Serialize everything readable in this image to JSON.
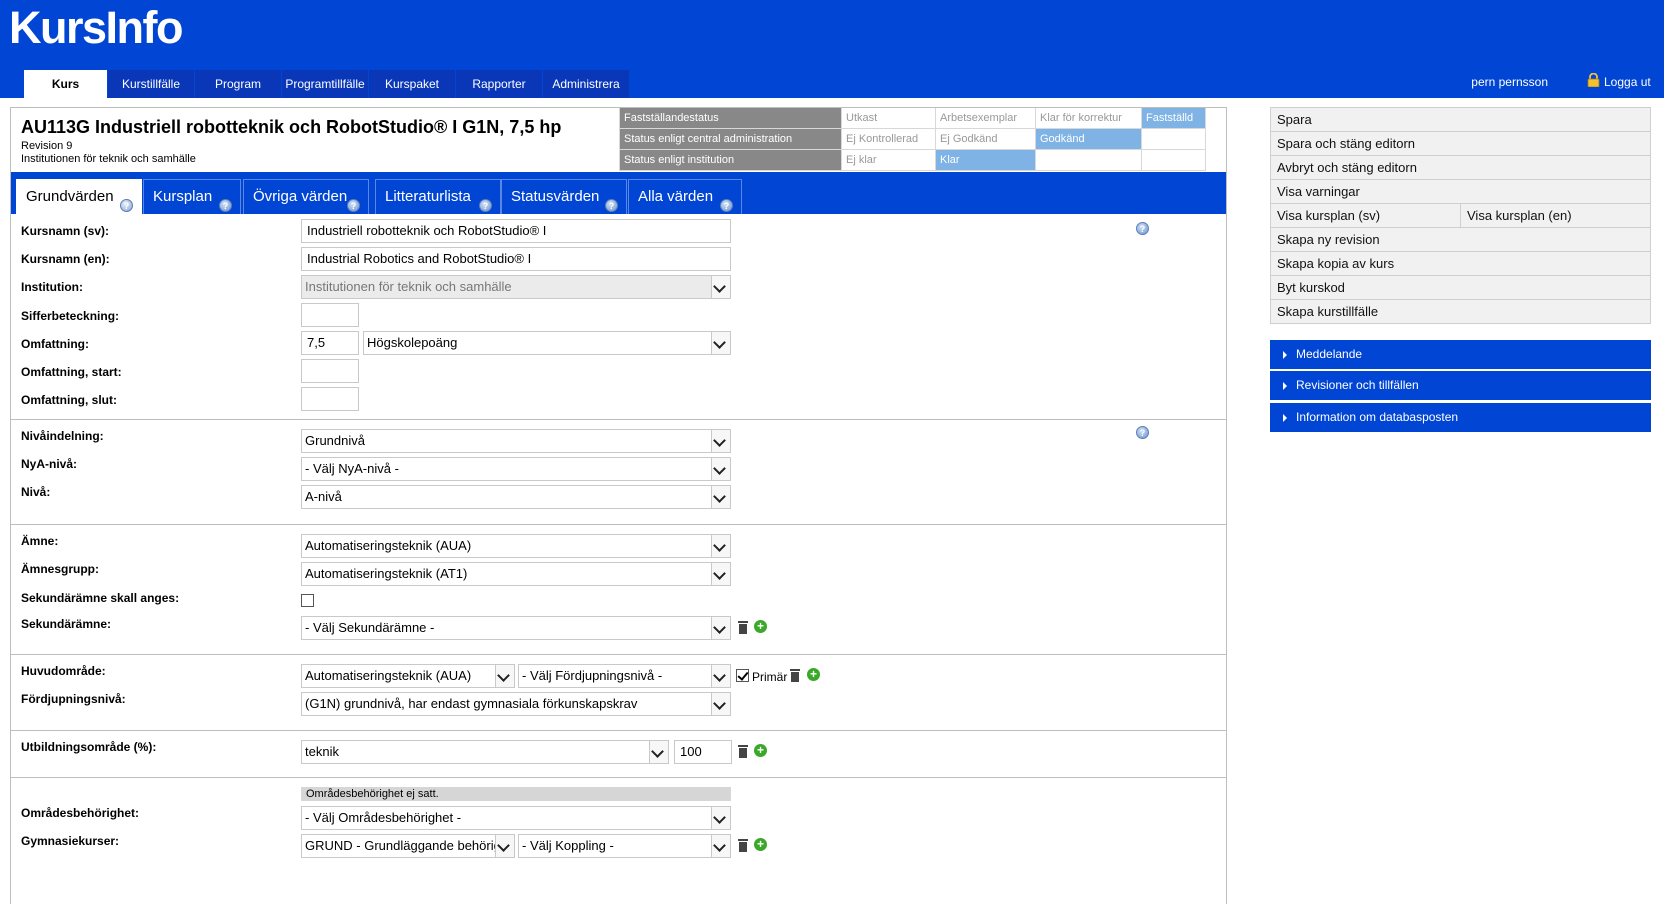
{
  "app": {
    "logo": "KursInfo"
  },
  "nav": {
    "items": [
      "Kurs",
      "Kurstillfälle",
      "Program",
      "Programtillfälle",
      "Kurspaket",
      "Rapporter",
      "Administrera"
    ],
    "active": "Kurs"
  },
  "user": {
    "name": "pern pernsson",
    "logout_label": "Logga ut"
  },
  "course": {
    "title": "AU113G Industriell robotteknik och RobotStudio® I G1N, 7,5 hp",
    "revision": "Revision 9",
    "institution": "Institutionen för teknik och samhälle"
  },
  "status": {
    "rows": [
      {
        "label": "Fastställandestatus",
        "values": [
          "Utkast",
          "Arbetsexemplar",
          "Klar för korrektur",
          "Fastställd"
        ],
        "active": "Fastställd"
      },
      {
        "label": "Status enligt central administration",
        "values": [
          "Ej Kontrollerad",
          "Ej Godkänd",
          "Godkänd",
          ""
        ],
        "active": "Godkänd"
      },
      {
        "label": "Status enligt institution",
        "values": [
          "Ej klar",
          "Klar",
          "",
          ""
        ],
        "active": "Klar"
      }
    ]
  },
  "tabs": [
    "Grundvärden",
    "Kursplan",
    "Övriga värden",
    "Litteraturlista",
    "Statusvärden",
    "Alla värden"
  ],
  "active_tab": "Grundvärden",
  "form": {
    "kursnamn_sv": {
      "label": "Kursnamn (sv):",
      "value": "Industriell robotteknik och RobotStudio® I"
    },
    "kursnamn_en": {
      "label": "Kursnamn (en):",
      "value": "Industrial Robotics and RobotStudio® I"
    },
    "institution": {
      "label": "Institution:",
      "value": "Institutionen för teknik och samhälle"
    },
    "sifferbeteckning": {
      "label": "Sifferbeteckning:",
      "value": ""
    },
    "omfattning": {
      "label": "Omfattning:",
      "value": "7,5",
      "unit": "Högskolepoäng"
    },
    "omfattning_start": {
      "label": "Omfattning, start:",
      "value": ""
    },
    "omfattning_slut": {
      "label": "Omfattning, slut:",
      "value": ""
    },
    "nivaindelning": {
      "label": "Nivåindelning:",
      "value": "Grundnivå"
    },
    "nya_niva": {
      "label": "NyA-nivå:",
      "value": "- Välj NyA-nivå -"
    },
    "niva": {
      "label": "Nivå:",
      "value": "A-nivå"
    },
    "amne": {
      "label": "Ämne:",
      "value": "Automatiseringsteknik (AUA)"
    },
    "amnesgrupp": {
      "label": "Ämnesgrupp:",
      "value": "Automatiseringsteknik (AT1)"
    },
    "sekundaramne_skall": {
      "label": "Sekundärämne skall anges:",
      "checked": false
    },
    "sekundaramne": {
      "label": "Sekundärämne:",
      "value": "- Välj Sekundärämne -"
    },
    "huvudomrade": {
      "label": "Huvudområde:",
      "value": "Automatiseringsteknik (AUA)",
      "fordjupning": "- Välj Fördjupningsnivå -",
      "primar_label": "Primär",
      "primar_checked": true
    },
    "fordjupningsniva": {
      "label": "Fördjupningsnivå:",
      "value": "(G1N) grundnivå, har endast gymnasiala förkunskapskrav"
    },
    "utbildningsomrade": {
      "label": "Utbildningsområde (%):",
      "value": "teknik",
      "percent": "100"
    },
    "omradesbehorighet_notice": "Områdesbehörighet ej satt.",
    "omradesbehorighet": {
      "label": "Områdesbehörighet:",
      "value": "- Välj Områdesbehörighet -"
    },
    "gymnasiekurser": {
      "label": "Gymnasiekurser:",
      "value": "GRUND - Grundläggande behörighet",
      "koppling": "- Välj Koppling -"
    }
  },
  "side": {
    "buttons": [
      "Spara",
      "Spara och stäng editorn",
      "Avbryt och stäng editorn",
      "Visa varningar",
      "Visa kursplan (sv)",
      "Visa kursplan (en)",
      "Skapa ny revision",
      "Skapa kopia av kurs",
      "Byt kurskod",
      "Skapa kurstillfälle"
    ],
    "accordions": [
      "Meddelande",
      "Revisioner och tillfällen",
      "Information om databasposten"
    ]
  }
}
